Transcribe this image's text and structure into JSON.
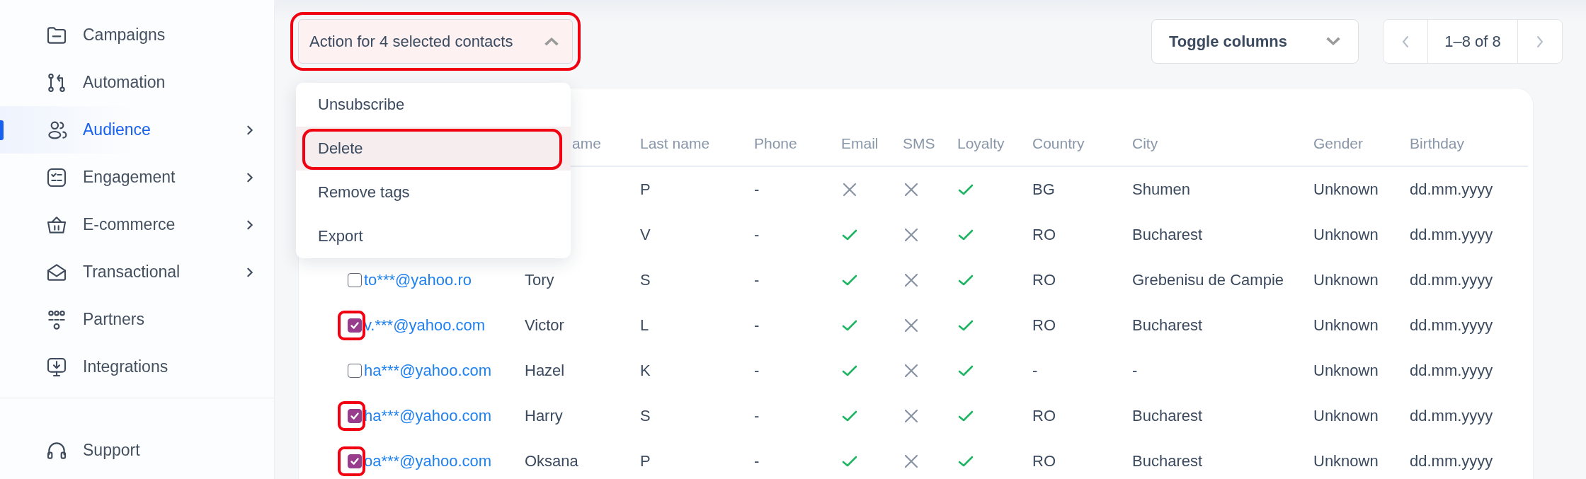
{
  "sidebar": {
    "items": [
      {
        "label": "Campaigns",
        "kind": "folder",
        "selected": false,
        "has_submenu": false
      },
      {
        "label": "Automation",
        "kind": "flow",
        "selected": false,
        "has_submenu": false
      },
      {
        "label": "Audience",
        "kind": "users",
        "selected": true,
        "has_submenu": true
      },
      {
        "label": "Engagement",
        "kind": "list",
        "selected": false,
        "has_submenu": true
      },
      {
        "label": "E-commerce",
        "kind": "basket",
        "selected": false,
        "has_submenu": true
      },
      {
        "label": "Transactional",
        "kind": "envelope",
        "selected": false,
        "has_submenu": true
      },
      {
        "label": "Partners",
        "kind": "group",
        "selected": false,
        "has_submenu": false
      },
      {
        "label": "Integrations",
        "kind": "monitor",
        "selected": false,
        "has_submenu": false
      }
    ],
    "footer_items": [
      {
        "label": "Support",
        "kind": "headset",
        "selected": false
      }
    ]
  },
  "action_dropdown": {
    "label": "Action for 4 selected contacts",
    "expanded": true,
    "highlighted": true
  },
  "action_menu": [
    {
      "label": "Unsubscribe",
      "selected": false,
      "highlighted": false
    },
    {
      "label": "Delete",
      "selected": true,
      "highlighted": true
    },
    {
      "label": "Remove tags",
      "selected": false,
      "highlighted": false
    },
    {
      "label": "Export",
      "selected": false,
      "highlighted": false
    }
  ],
  "toggle_columns": {
    "label": "Toggle columns"
  },
  "pagination": {
    "label": "1–8 of 8"
  },
  "table": {
    "columns": [
      "ame",
      "Last name",
      "Phone",
      "Email",
      "SMS",
      "Loyalty",
      "Country",
      "City",
      "Gender",
      "Birthday"
    ],
    "rows": [
      {
        "last_name": "P",
        "phone": "-",
        "email_ok": false,
        "sms_ok": false,
        "loyalty_ok": true,
        "country": "BG",
        "city": "Shumen",
        "gender": "Unknown",
        "birthday": "dd.mm.yyyy"
      },
      {
        "last_name": "V",
        "phone": "-",
        "email_ok": true,
        "sms_ok": false,
        "loyalty_ok": true,
        "country": "RO",
        "city": "Bucharest",
        "gender": "Unknown",
        "birthday": "dd.mm.yyyy"
      },
      {
        "checked": false,
        "email": "to***@yahoo.ro",
        "first_name": "Tory",
        "last_name": "S",
        "phone": "-",
        "email_ok": true,
        "sms_ok": false,
        "loyalty_ok": true,
        "country": "RO",
        "city": "Grebenisu de Campie",
        "gender": "Unknown",
        "birthday": "dd.mm.yyyy"
      },
      {
        "checked": true,
        "email": "v.***@yahoo.com",
        "first_name": "Victor",
        "last_name": "L",
        "phone": "-",
        "email_ok": true,
        "sms_ok": false,
        "loyalty_ok": true,
        "country": "RO",
        "city": "Bucharest",
        "gender": "Unknown",
        "birthday": "dd.mm.yyyy"
      },
      {
        "checked": false,
        "email": "ha***@yahoo.com",
        "first_name": "Hazel",
        "last_name": "K",
        "phone": "-",
        "email_ok": true,
        "sms_ok": false,
        "loyalty_ok": true,
        "country": "-",
        "city": "-",
        "gender": "Unknown",
        "birthday": "dd.mm.yyyy"
      },
      {
        "checked": true,
        "email": "ha***@yahoo.com",
        "first_name": "Harry",
        "last_name": "S",
        "phone": "-",
        "email_ok": true,
        "sms_ok": false,
        "loyalty_ok": true,
        "country": "RO",
        "city": "Bucharest",
        "gender": "Unknown",
        "birthday": "dd.mm.yyyy"
      },
      {
        "checked": true,
        "email": "oa***@yahoo.com",
        "first_name": "Oksana",
        "last_name": "P",
        "phone": "-",
        "email_ok": true,
        "sms_ok": false,
        "loyalty_ok": true,
        "country": "RO",
        "city": "Bucharest",
        "gender": "Unknown",
        "birthday": "dd.mm.yyyy"
      }
    ]
  }
}
